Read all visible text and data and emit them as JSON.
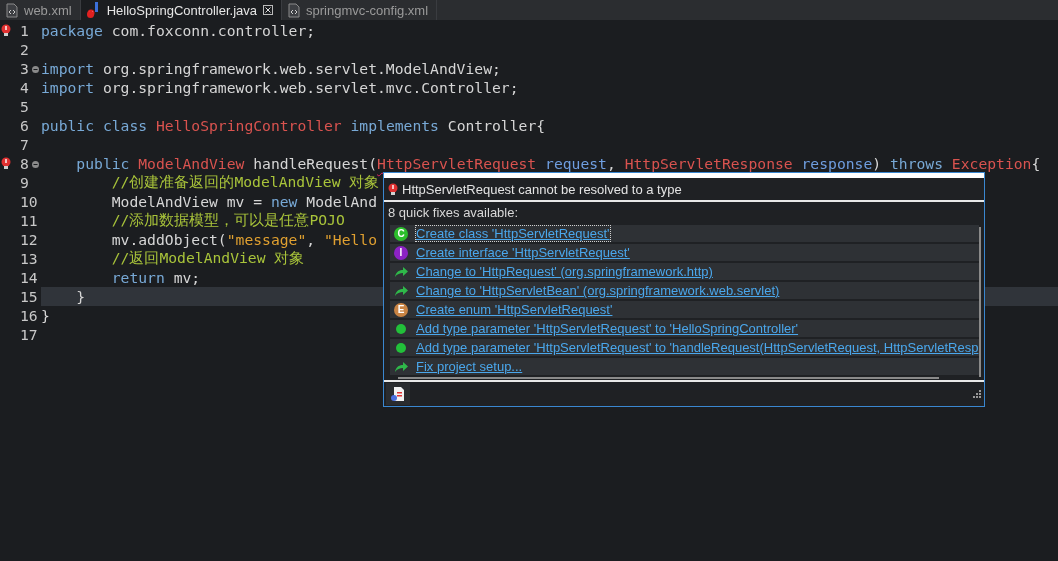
{
  "tabs": [
    {
      "label": "web.xml",
      "kind": "xml",
      "selected": false,
      "closable": false,
      "error": false
    },
    {
      "label": "HelloSpringController.java",
      "kind": "java",
      "selected": true,
      "closable": true,
      "error": true
    },
    {
      "label": "springmvc-config.xml",
      "kind": "xml",
      "selected": false,
      "closable": false,
      "error": false
    }
  ],
  "lines": [
    {
      "number": "1",
      "error": true,
      "fold": false,
      "current": false,
      "tokens": [
        {
          "text": "package",
          "kind": "keyword"
        },
        {
          "text": " com.foxconn.controller;",
          "kind": "plain"
        }
      ]
    },
    {
      "number": "2",
      "error": false,
      "fold": false,
      "current": false
    },
    {
      "number": "3",
      "error": false,
      "fold": true,
      "current": false,
      "tokens": [
        {
          "text": "import",
          "kind": "keyword"
        },
        {
          "text": " org.springframework.web.servlet.ModelAndView;",
          "kind": "plain"
        }
      ]
    },
    {
      "number": "4",
      "error": false,
      "fold": false,
      "current": false,
      "tokens": [
        {
          "text": "import",
          "kind": "keyword"
        },
        {
          "text": " org.springframework.web.servlet.mvc.Controller;",
          "kind": "plain"
        }
      ]
    },
    {
      "number": "5",
      "error": false,
      "fold": false,
      "current": false
    },
    {
      "number": "6",
      "error": false,
      "fold": false,
      "current": false,
      "tokens": [
        {
          "text": "public class ",
          "kind": "keyword"
        },
        {
          "text": "HelloSpringController",
          "kind": "type"
        },
        {
          "text": " implements ",
          "kind": "keyword"
        },
        {
          "text": "Controller{",
          "kind": "plain"
        }
      ]
    },
    {
      "number": "7",
      "error": false,
      "fold": false,
      "current": false
    },
    {
      "number": "8",
      "error": true,
      "fold": true,
      "current": false,
      "tokens": [
        {
          "text": "    public ",
          "kind": "keyword"
        },
        {
          "text": "ModelAndView",
          "kind": "type"
        },
        {
          "text": " handleRequest(",
          "kind": "plain"
        },
        {
          "text": "HttpServletRequest",
          "kind": "error"
        },
        {
          "text": " request",
          "kind": "param"
        },
        {
          "text": ", ",
          "kind": "plain"
        },
        {
          "text": "HttpServletResponse",
          "kind": "error"
        },
        {
          "text": " response",
          "kind": "param"
        },
        {
          "text": ") ",
          "kind": "plain"
        },
        {
          "text": "throws ",
          "kind": "keyword"
        },
        {
          "text": "Exception",
          "kind": "type"
        },
        {
          "text": "{",
          "kind": "plain"
        }
      ]
    },
    {
      "number": "9",
      "error": false,
      "fold": false,
      "current": false,
      "tokens": [
        {
          "text": "        //创建准备返回的ModelAndView 对象",
          "kind": "comment"
        }
      ]
    },
    {
      "number": "10",
      "error": false,
      "fold": false,
      "current": false,
      "tokens": [
        {
          "text": "        ModelAndView mv = ",
          "kind": "plain"
        },
        {
          "text": "new",
          "kind": "keyword"
        },
        {
          "text": " ModelAnd",
          "kind": "plain"
        }
      ]
    },
    {
      "number": "11",
      "error": false,
      "fold": false,
      "current": false,
      "tokens": [
        {
          "text": "        //添加数据模型，可以是任意POJO",
          "kind": "comment"
        }
      ]
    },
    {
      "number": "12",
      "error": false,
      "fold": false,
      "current": false,
      "tokens": [
        {
          "text": "        mv.addObject(",
          "kind": "plain"
        },
        {
          "text": "\"message\"",
          "kind": "string"
        },
        {
          "text": ", ",
          "kind": "plain"
        },
        {
          "text": "\"Hello",
          "kind": "string"
        }
      ]
    },
    {
      "number": "13",
      "error": false,
      "fold": false,
      "current": false,
      "tokens": [
        {
          "text": "        //返回ModelAndView 对象",
          "kind": "comment"
        }
      ]
    },
    {
      "number": "14",
      "error": false,
      "fold": false,
      "current": false,
      "tokens": [
        {
          "text": "        return",
          "kind": "keyword"
        },
        {
          "text": " mv;",
          "kind": "plain"
        }
      ]
    },
    {
      "number": "15",
      "error": false,
      "fold": false,
      "current": true,
      "tokens": [
        {
          "text": "    }",
          "kind": "plain"
        }
      ]
    },
    {
      "number": "16",
      "error": false,
      "fold": false,
      "current": false,
      "tokens": [
        {
          "text": "}",
          "kind": "plain"
        }
      ]
    },
    {
      "number": "17",
      "error": false,
      "fold": false,
      "current": false
    }
  ],
  "quick_fix": {
    "problem": "HttpServletRequest cannot be resolved to a type",
    "summary": "8 quick fixes available:",
    "fixes": [
      {
        "kind": "letter",
        "letter": "C",
        "color": "#2cbf2c",
        "label": "Create class 'HttpServletRequest'",
        "selected": true
      },
      {
        "kind": "letter",
        "letter": "I",
        "color": "#8c22c4",
        "label": "Create interface 'HttpServletRequest'",
        "selected": false
      },
      {
        "kind": "arrow",
        "label": "Change to 'HttpRequest' (org.springframework.http)",
        "selected": false
      },
      {
        "kind": "arrow",
        "label": "Change to 'HttpServletBean' (org.springframework.web.servlet)",
        "selected": false
      },
      {
        "kind": "letter",
        "letter": "E",
        "color": "#c98444",
        "label": "Create enum 'HttpServletRequest'",
        "selected": false
      },
      {
        "kind": "dot",
        "label": "Add type parameter 'HttpServletRequest' to 'HelloSpringController'",
        "selected": false
      },
      {
        "kind": "dot",
        "label": "Add type parameter 'HttpServletRequest' to 'handleRequest(HttpServletRequest, HttpServletResp",
        "selected": false
      },
      {
        "kind": "arrow",
        "label": "Fix project setup...",
        "selected": false
      }
    ]
  }
}
